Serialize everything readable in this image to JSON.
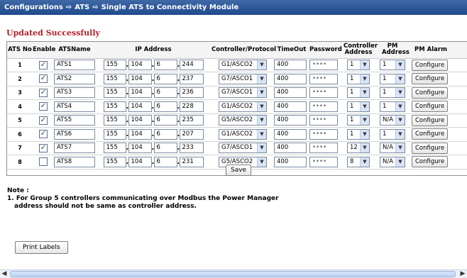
{
  "breadcrumb": [
    "Configurations",
    "ATS",
    "Single ATS to Connectivity Module"
  ],
  "status_message": "Updated Successfully",
  "columns": [
    "ATS No",
    "Enable",
    "ATSName",
    "IP Address",
    "Controller/Protocol",
    "TimeOut",
    "Password",
    "Controller Address",
    "PM Address",
    "PM Alarm"
  ],
  "rows": [
    {
      "no": "1",
      "enabled": true,
      "name": "ATS1",
      "ip": [
        "155",
        "104",
        "6",
        "244"
      ],
      "protocol": "G1/ASCO2",
      "timeout": "400",
      "password": "••••",
      "controller_address": "1",
      "pm_address": "1",
      "configure": "Configure"
    },
    {
      "no": "2",
      "enabled": true,
      "name": "ATS2",
      "ip": [
        "155",
        "104",
        "6",
        "237"
      ],
      "protocol": "G7/ASCO1",
      "timeout": "400",
      "password": "••••",
      "controller_address": "1",
      "pm_address": "1",
      "configure": "Configure"
    },
    {
      "no": "3",
      "enabled": true,
      "name": "ATS3",
      "ip": [
        "155",
        "104",
        "6",
        "236"
      ],
      "protocol": "G7/ASCO1",
      "timeout": "400",
      "password": "••••",
      "controller_address": "1",
      "pm_address": "1",
      "configure": "Configure"
    },
    {
      "no": "4",
      "enabled": true,
      "name": "ATS4",
      "ip": [
        "155",
        "104",
        "6",
        "228"
      ],
      "protocol": "G1/ASCO2",
      "timeout": "400",
      "password": "••••",
      "controller_address": "1",
      "pm_address": "1",
      "configure": "Configure"
    },
    {
      "no": "5",
      "enabled": true,
      "name": "ATS5",
      "ip": [
        "155",
        "104",
        "6",
        "235"
      ],
      "protocol": "G5/ASCO2",
      "timeout": "400",
      "password": "••••",
      "controller_address": "1",
      "pm_address": "N/A",
      "configure": "Configure"
    },
    {
      "no": "6",
      "enabled": true,
      "name": "ATS6",
      "ip": [
        "155",
        "104",
        "6",
        "207"
      ],
      "protocol": "G1/ASCO2",
      "timeout": "400",
      "password": "••••",
      "controller_address": "1",
      "pm_address": "1",
      "configure": "Configure"
    },
    {
      "no": "7",
      "enabled": true,
      "name": "ATS7",
      "ip": [
        "155",
        "104",
        "6",
        "233"
      ],
      "protocol": "G7/ASCO1",
      "timeout": "400",
      "password": "••••",
      "controller_address": "12",
      "pm_address": "N/A",
      "configure": "Configure"
    },
    {
      "no": "8",
      "enabled": false,
      "name": "ATS8",
      "ip": [
        "155",
        "104",
        "6",
        "231"
      ],
      "protocol": "G5/ASCO2",
      "timeout": "400",
      "password": "••••",
      "controller_address": "8",
      "pm_address": "N/A",
      "configure": "Configure"
    }
  ],
  "save_label": "Save",
  "note_title": "Note :",
  "note_line1": "1. For Group 5 controllers communicating over Modbus the Power Manager",
  "note_line2": "address should not be same as controller address.",
  "print_label": "Print Labels",
  "colors": {
    "title_bar": "#2b5496",
    "status": "#b3202a",
    "background": "#ffffff"
  }
}
